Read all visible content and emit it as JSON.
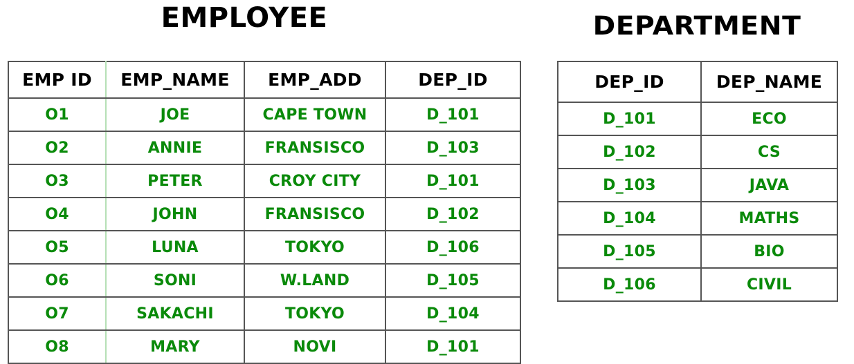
{
  "colors": {
    "data_text": "#0a8a0a",
    "header_text": "#000000",
    "border": "#555555",
    "soft_border": "#b6e0b6",
    "background": "#ffffff"
  },
  "employee": {
    "title": "EMPLOYEE",
    "columns": [
      "EMP ID",
      "EMP_NAME",
      "EMP_ADD",
      "DEP_ID"
    ],
    "rows": [
      {
        "emp_id": "O1",
        "emp_name": "JOE",
        "emp_add": "CAPE TOWN",
        "dep_id": "D_101"
      },
      {
        "emp_id": "O2",
        "emp_name": "ANNIE",
        "emp_add": "FRANSISCO",
        "dep_id": "D_103"
      },
      {
        "emp_id": "O3",
        "emp_name": "PETER",
        "emp_add": "CROY CITY",
        "dep_id": "D_101"
      },
      {
        "emp_id": "O4",
        "emp_name": "JOHN",
        "emp_add": "FRANSISCO",
        "dep_id": "D_102"
      },
      {
        "emp_id": "O5",
        "emp_name": "LUNA",
        "emp_add": "TOKYO",
        "dep_id": "D_106"
      },
      {
        "emp_id": "O6",
        "emp_name": "SONI",
        "emp_add": "W.LAND",
        "dep_id": "D_105"
      },
      {
        "emp_id": "O7",
        "emp_name": "SAKACHI",
        "emp_add": "TOKYO",
        "dep_id": "D_104"
      },
      {
        "emp_id": "O8",
        "emp_name": "MARY",
        "emp_add": "NOVI",
        "dep_id": "D_101"
      }
    ]
  },
  "department": {
    "title": "DEPARTMENT",
    "columns": [
      "DEP_ID",
      "DEP_NAME"
    ],
    "rows": [
      {
        "dep_id": "D_101",
        "dep_name": "ECO"
      },
      {
        "dep_id": "D_102",
        "dep_name": "CS"
      },
      {
        "dep_id": "D_103",
        "dep_name": "JAVA"
      },
      {
        "dep_id": "D_104",
        "dep_name": "MATHS"
      },
      {
        "dep_id": "D_105",
        "dep_name": "BIO"
      },
      {
        "dep_id": "D_106",
        "dep_name": "CIVIL"
      }
    ]
  }
}
